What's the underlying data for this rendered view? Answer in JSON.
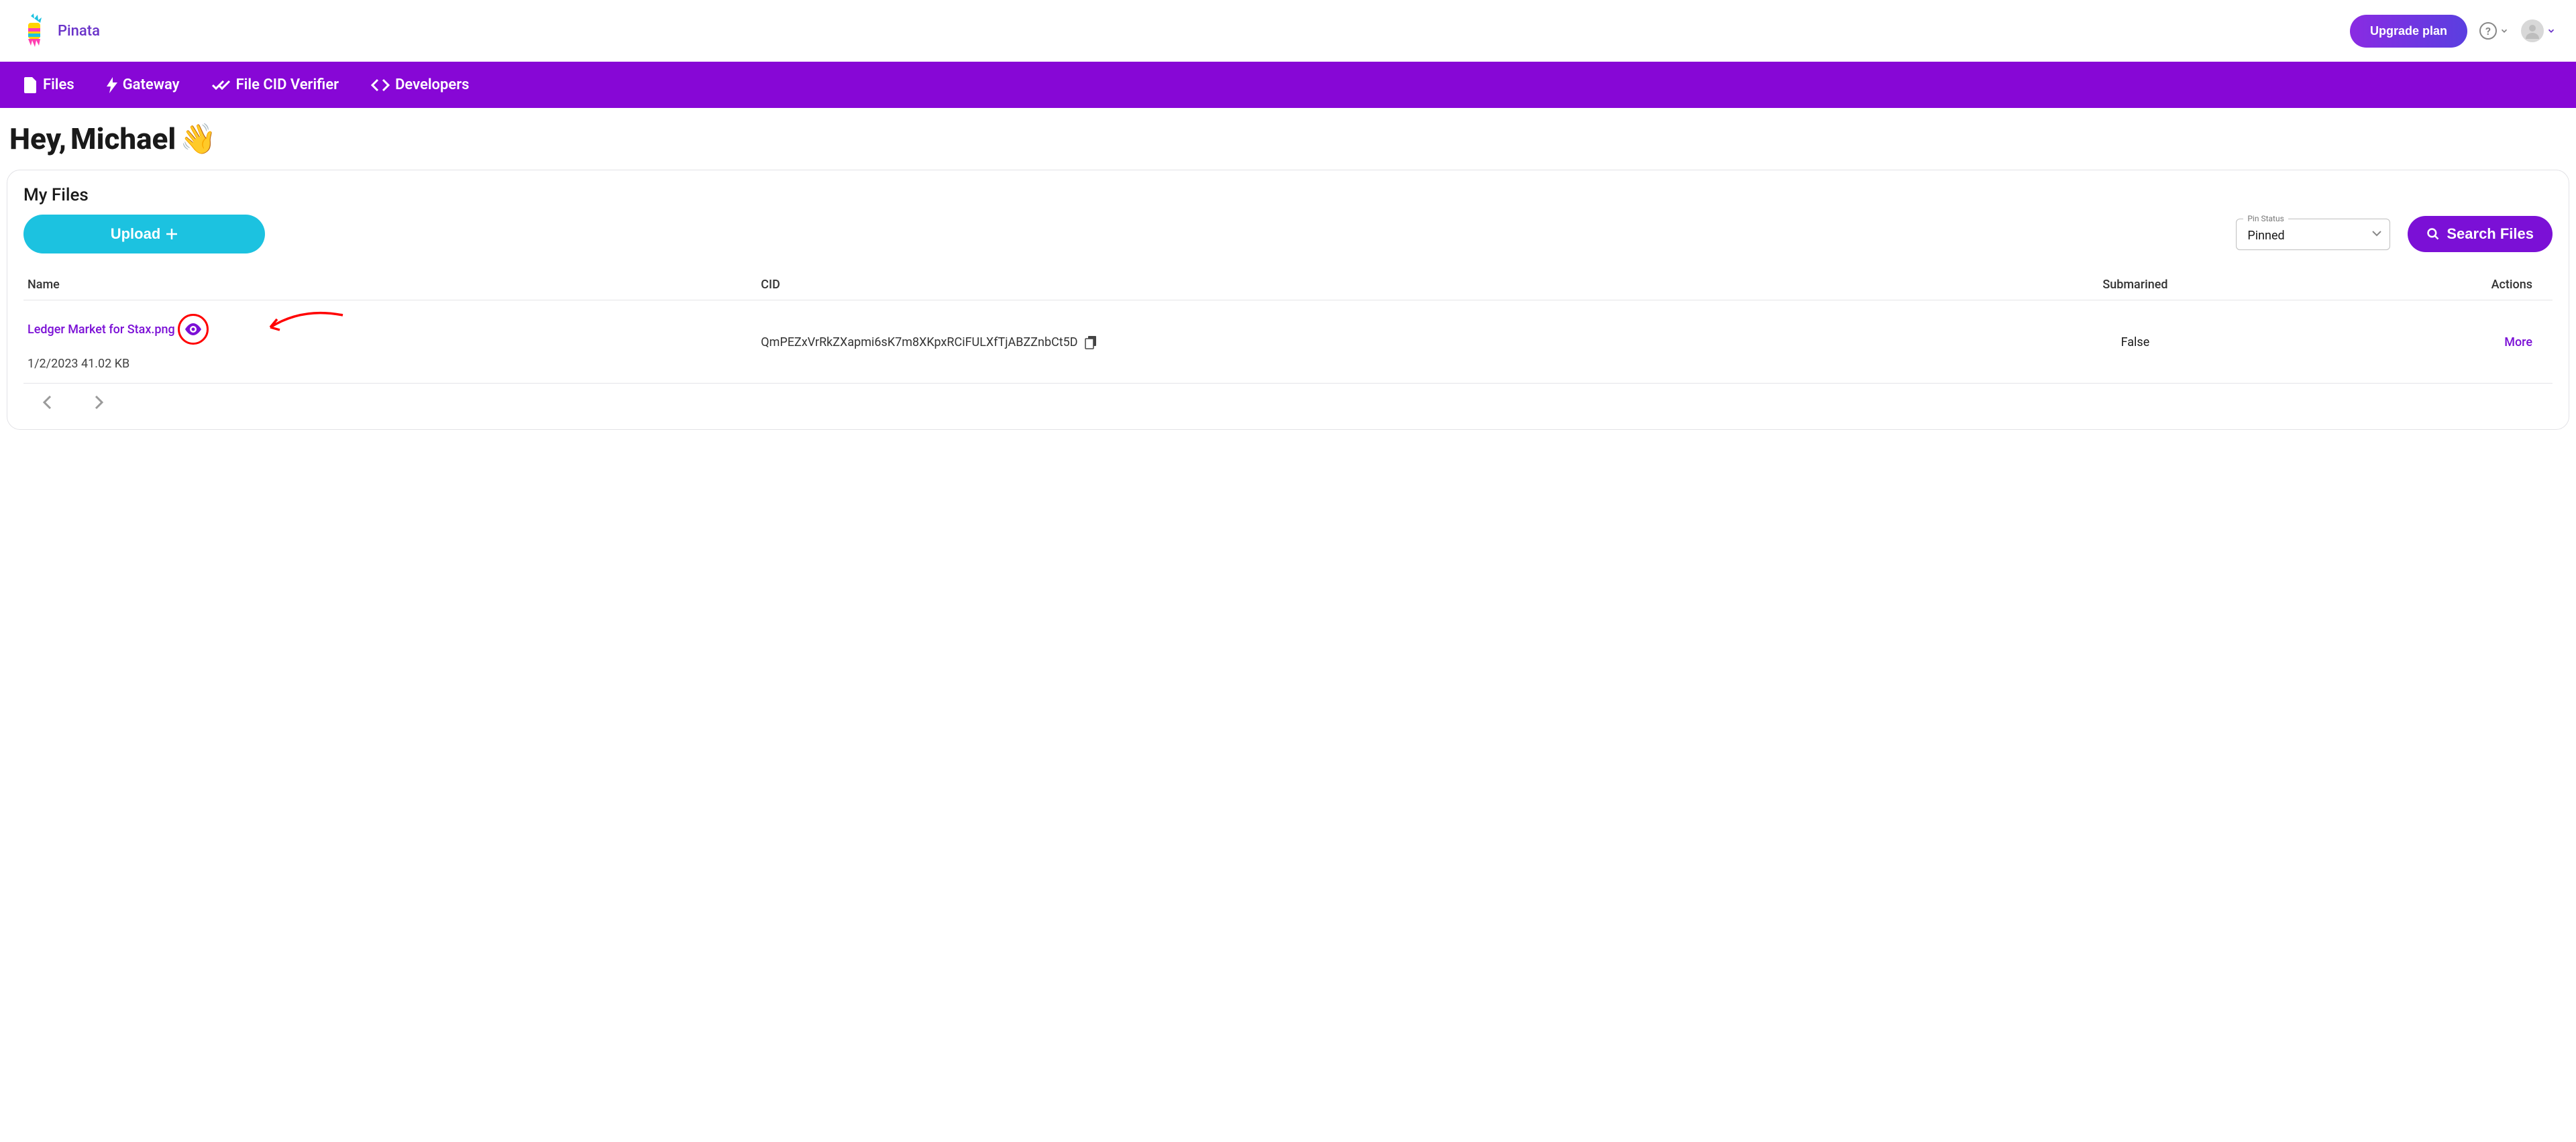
{
  "brand": "Pinata",
  "header": {
    "upgrade": "Upgrade plan"
  },
  "nav": {
    "files": "Files",
    "gateway": "Gateway",
    "verifier": "File CID Verifier",
    "developers": "Developers"
  },
  "greeting_prefix": "Hey, ",
  "greeting_name": "Michael",
  "section_title": "My Files",
  "upload_label": "Upload",
  "pin_status_label": "Pin Status",
  "pin_status_value": "Pinned",
  "search_label": "Search Files",
  "columns": {
    "name": "Name",
    "cid": "CID",
    "submarined": "Submarined",
    "actions": "Actions"
  },
  "rows": [
    {
      "name": "Ledger Market for Stax.png",
      "date": "1/2/2023",
      "size": "41.02 KB",
      "cid": "QmPEZxVrRkZXapmi6sK7m8XKpxRCiFULXfTjABZZnbCt5D",
      "submarined": "False",
      "action": "More"
    }
  ]
}
